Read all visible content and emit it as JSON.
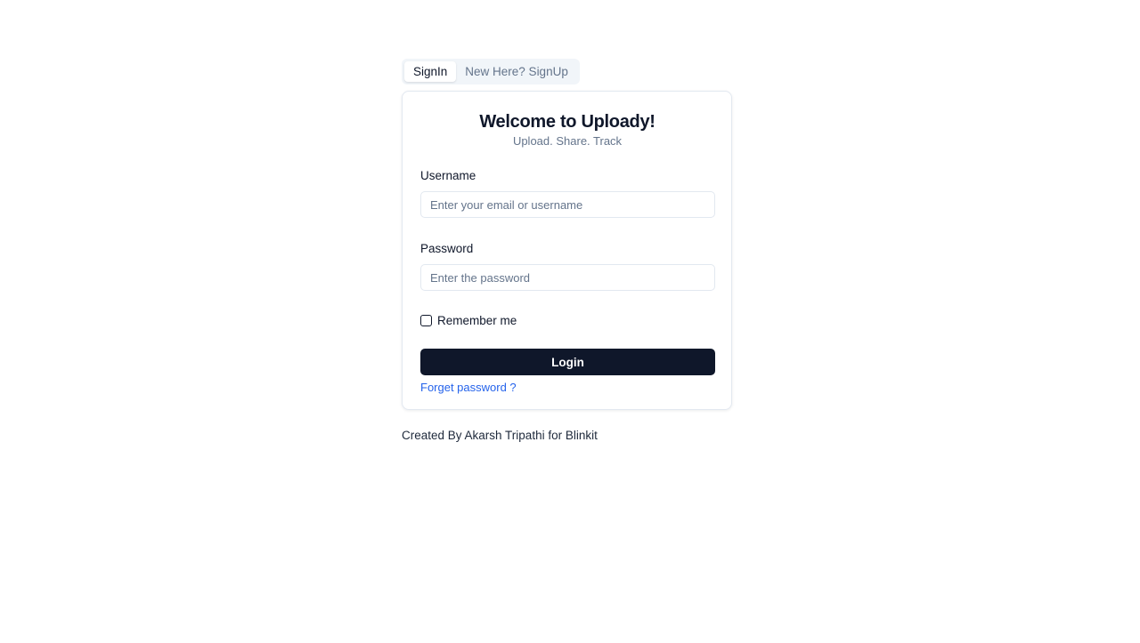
{
  "tabs": [
    {
      "label": "SignIn",
      "active": true
    },
    {
      "label": "New Here? SignUp",
      "active": false
    }
  ],
  "card": {
    "title": "Welcome to Uploady!",
    "subtitle": "Upload. Share. Track",
    "username": {
      "label": "Username",
      "placeholder": "Enter your email or username",
      "value": ""
    },
    "password": {
      "label": "Password",
      "placeholder": "Enter the password",
      "value": ""
    },
    "remember": {
      "label": "Remember me",
      "checked": false
    },
    "login_label": "Login",
    "forget_label": "Forget password ?"
  },
  "footer": {
    "text": "Created By Akarsh Tripathi for Blinkit"
  },
  "colors": {
    "primary": "#0f172a",
    "link": "#2563eb",
    "muted": "#64748b",
    "border": "#e2e8f0"
  }
}
